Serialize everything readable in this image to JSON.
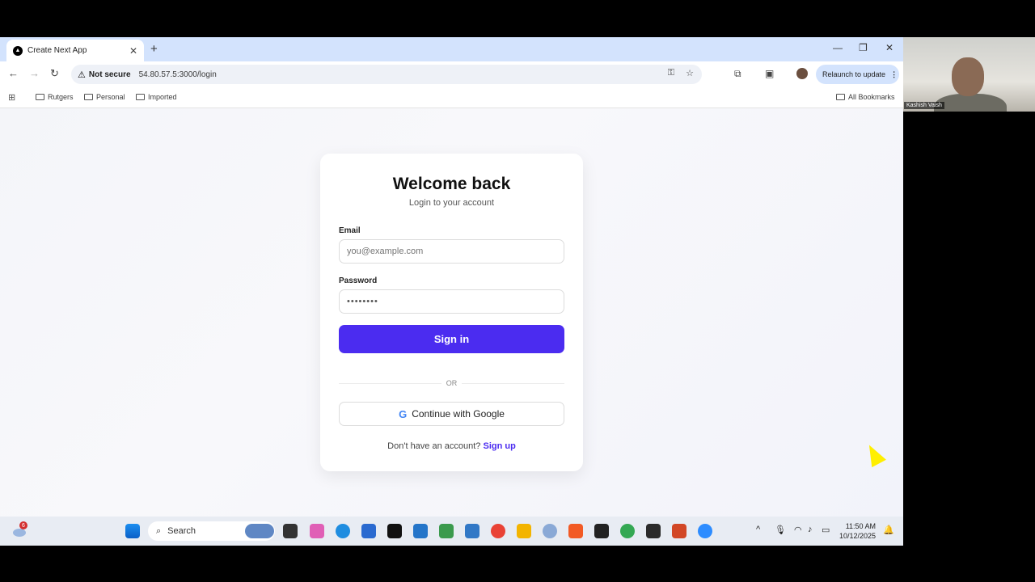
{
  "browser": {
    "tab_title": "Create Next App",
    "not_secure": "Not secure",
    "url": "54.80.57.5:3000/login",
    "relaunch": "Relaunch to update",
    "bookmarks": [
      "Rutgers",
      "Personal",
      "Imported"
    ],
    "all_bookmarks": "All Bookmarks"
  },
  "login": {
    "title": "Welcome back",
    "subtitle": "Login to your account",
    "email_label": "Email",
    "email_placeholder": "you@example.com",
    "password_label": "Password",
    "password_value": "••••••••",
    "signin_label": "Sign in",
    "or_text": "OR",
    "google_label": "Continue with Google",
    "signup_prompt": "Don't have an account?",
    "signup_link": "Sign up"
  },
  "next_badge": "N",
  "webcam": {
    "name": "Kashish Vaish"
  },
  "taskbar": {
    "search": "Search",
    "weather_badge": "6",
    "time": "11:50 AM",
    "date": "10/12/2025"
  },
  "colors": {
    "accent": "#4b2cf0",
    "tabbar": "#d3e3fd"
  }
}
